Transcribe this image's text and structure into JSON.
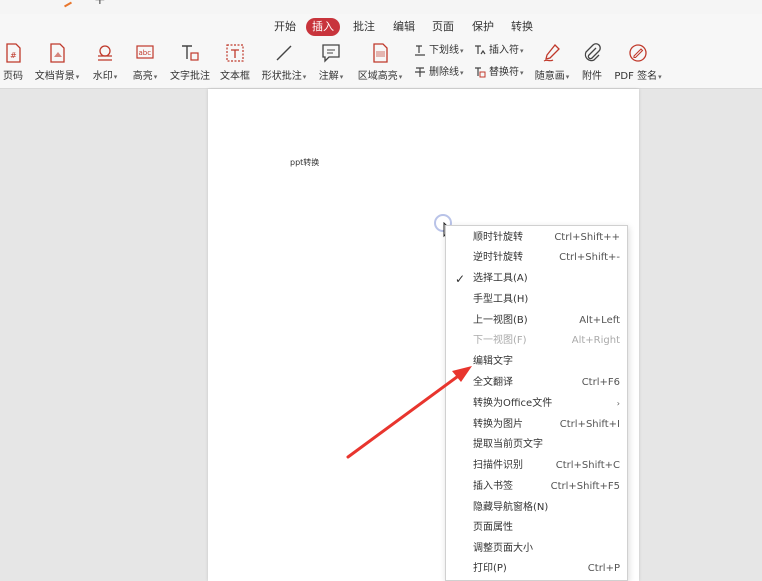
{
  "tabs": [
    {
      "label": "开始",
      "active": false
    },
    {
      "label": "插入",
      "active": true
    },
    {
      "label": "批注",
      "active": false
    },
    {
      "label": "编辑",
      "active": false
    },
    {
      "label": "页面",
      "active": false
    },
    {
      "label": "保护",
      "active": false
    },
    {
      "label": "转换",
      "active": false
    }
  ],
  "tools": [
    {
      "label": "页码",
      "icon": "page-number-icon",
      "dropdown": false
    },
    {
      "label": "文档背景",
      "icon": "document-background-icon",
      "dropdown": true
    },
    {
      "label": "水印",
      "icon": "watermark-icon",
      "dropdown": true
    },
    {
      "label": "高亮",
      "icon": "highlight-icon",
      "dropdown": true
    },
    {
      "label": "文字批注",
      "icon": "text-annotation-icon",
      "dropdown": false
    },
    {
      "label": "文本框",
      "icon": "text-box-icon",
      "dropdown": false
    },
    {
      "label": "形状批注",
      "icon": "shape-annotation-icon",
      "dropdown": true
    },
    {
      "label": "注解",
      "icon": "note-icon",
      "dropdown": true
    },
    {
      "label": "区域高亮",
      "icon": "area-highlight-icon",
      "dropdown": true
    }
  ],
  "small_tools": [
    {
      "label": "下划线",
      "icon": "underline-icon",
      "dropdown": true
    },
    {
      "label": "删除线",
      "icon": "strikethrough-icon",
      "dropdown": true
    },
    {
      "label": "插入符",
      "icon": "insert-caret-icon",
      "dropdown": true
    },
    {
      "label": "替换符",
      "icon": "replace-mark-icon",
      "dropdown": true
    }
  ],
  "right_tools": [
    {
      "label": "随意画",
      "icon": "freehand-pen-icon",
      "dropdown": true
    },
    {
      "label": "附件",
      "icon": "paperclip-icon",
      "dropdown": false
    },
    {
      "label": "PDF 签名",
      "icon": "pdf-signature-icon",
      "dropdown": true
    }
  ],
  "page": {
    "text": "ppt转换"
  },
  "context_menu": [
    {
      "label": "顺时针旋转",
      "shortcut": "Ctrl+Shift++",
      "checked": false,
      "disabled": false,
      "submenu": false
    },
    {
      "label": "逆时针旋转",
      "shortcut": "Ctrl+Shift+-",
      "checked": false,
      "disabled": false,
      "submenu": false
    },
    {
      "label": "选择工具(A)",
      "shortcut": "",
      "checked": true,
      "disabled": false,
      "submenu": false
    },
    {
      "label": "手型工具(H)",
      "shortcut": "",
      "checked": false,
      "disabled": false,
      "submenu": false
    },
    {
      "label": "上一视图(B)",
      "shortcut": "Alt+Left",
      "checked": false,
      "disabled": false,
      "submenu": false
    },
    {
      "label": "下一视图(F)",
      "shortcut": "Alt+Right",
      "checked": false,
      "disabled": true,
      "submenu": false
    },
    {
      "label": "编辑文字",
      "shortcut": "",
      "checked": false,
      "disabled": false,
      "submenu": false
    },
    {
      "label": "全文翻译",
      "shortcut": "Ctrl+F6",
      "checked": false,
      "disabled": false,
      "submenu": false
    },
    {
      "label": "转换为Office文件",
      "shortcut": "",
      "checked": false,
      "disabled": false,
      "submenu": true
    },
    {
      "label": "转换为图片",
      "shortcut": "Ctrl+Shift+I",
      "checked": false,
      "disabled": false,
      "submenu": false
    },
    {
      "label": "提取当前页文字",
      "shortcut": "",
      "checked": false,
      "disabled": false,
      "submenu": false
    },
    {
      "label": "扫描件识别",
      "shortcut": "Ctrl+Shift+C",
      "checked": false,
      "disabled": false,
      "submenu": false
    },
    {
      "label": "插入书签",
      "shortcut": "Ctrl+Shift+F5",
      "checked": false,
      "disabled": false,
      "submenu": false
    },
    {
      "label": "隐藏导航窗格(N)",
      "shortcut": "",
      "checked": false,
      "disabled": false,
      "submenu": false
    },
    {
      "label": "页面属性",
      "shortcut": "",
      "checked": false,
      "disabled": false,
      "submenu": false
    },
    {
      "label": "调整页面大小",
      "shortcut": "",
      "checked": false,
      "disabled": false,
      "submenu": false
    },
    {
      "label": "打印(P)",
      "shortcut": "Ctrl+P",
      "checked": false,
      "disabled": false,
      "submenu": false
    }
  ],
  "colors": {
    "accent": "#c8343c",
    "icon_red": "#c0392b",
    "arrow_red": "#e8352e"
  }
}
